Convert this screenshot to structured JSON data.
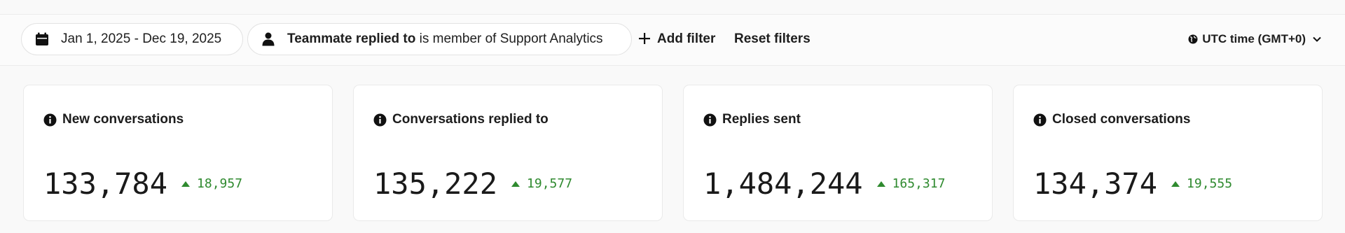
{
  "filters": {
    "date_range": "Jan 1, 2025 - Dec 19, 2025",
    "teammate_filter": {
      "field": "Teammate replied to",
      "condition": "is member of Support Analytics"
    },
    "add_filter_label": "Add filter",
    "reset_filters_label": "Reset filters",
    "timezone_label": "UTC time (GMT+0)"
  },
  "cards": [
    {
      "title": "New conversations",
      "value": "133,784",
      "delta": "18,957",
      "trend": "up"
    },
    {
      "title": "Conversations replied to",
      "value": "135,222",
      "delta": "19,577",
      "trend": "up"
    },
    {
      "title": "Replies sent",
      "value": "1,484,244",
      "delta": "165,317",
      "trend": "up"
    },
    {
      "title": "Closed conversations",
      "value": "134,374",
      "delta": "19,555",
      "trend": "up"
    }
  ],
  "colors": {
    "positive_delta": "#2f8a2f",
    "card_border": "#eaeaea",
    "background": "#f9f9f9"
  },
  "icons": {
    "date": "calendar-icon",
    "teammate": "person-icon",
    "add": "plus-icon",
    "timezone": "globe-icon",
    "dropdown": "chevron-down-icon",
    "card_info": "info-icon",
    "trend_up": "triangle-up-icon"
  }
}
